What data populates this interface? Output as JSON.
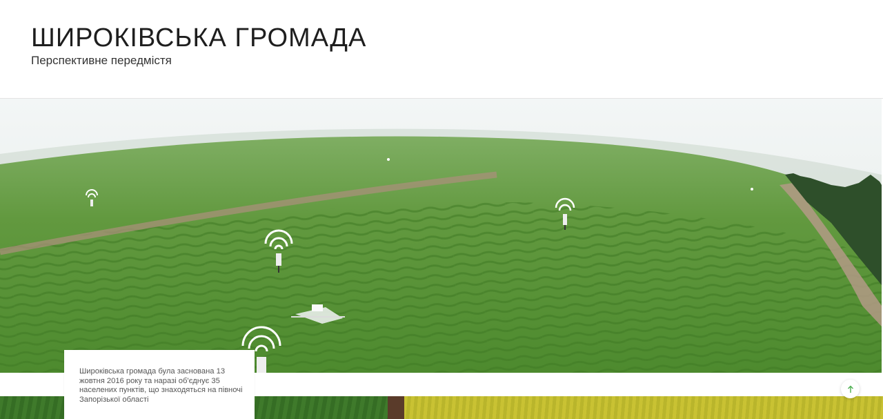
{
  "header": {
    "title": "ШИРОКІВСЬКА ГРОМАДА",
    "subtitle": "Перспективне передмістя"
  },
  "hero": {
    "icons": [
      "wifi-signal-icon",
      "sensor-post-icon",
      "drone-icon"
    ],
    "colors": {
      "sky": "#e9eeef",
      "field": "#5f9a3f",
      "rows": "#4f8a33",
      "path": "#a8907a",
      "trees": "#2e4f2a"
    }
  },
  "info_card": {
    "text": "Широківська громада була заснована 13 жовтня 2016 року та наразі об'єднує 35 населених пунктів, що знаходяться на півночі Запорізької області"
  },
  "scroll_top": {
    "icon": "arrow-up-icon",
    "color": "#4caf50"
  }
}
